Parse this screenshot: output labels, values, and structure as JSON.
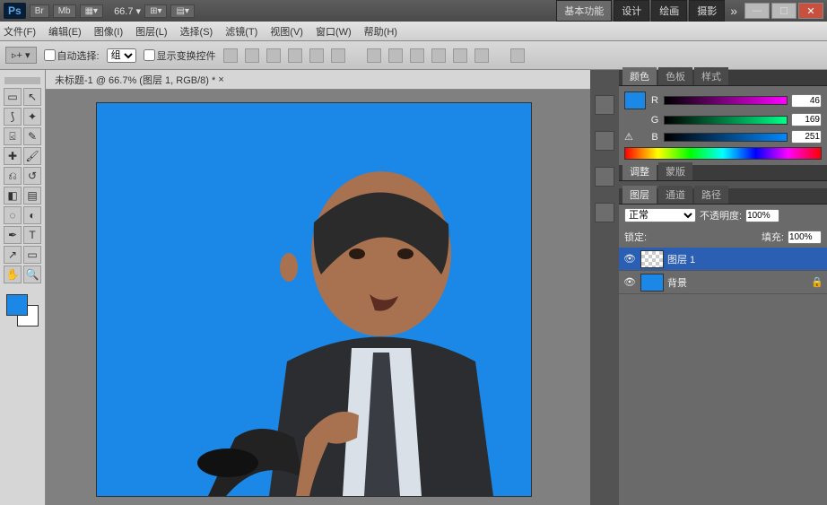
{
  "titlebar": {
    "ps": "Ps",
    "br": "Br",
    "mb": "Mb",
    "zoom_value": "66.7",
    "workspaces": [
      "基本功能",
      "设计",
      "绘画",
      "摄影"
    ],
    "arrow": "»"
  },
  "menubar": {
    "items": [
      "文件(F)",
      "编辑(E)",
      "图像(I)",
      "图层(L)",
      "选择(S)",
      "滤镜(T)",
      "视图(V)",
      "窗口(W)",
      "帮助(H)"
    ]
  },
  "optbar": {
    "auto_select": "自动选择:",
    "group": "组",
    "transform": "显示变换控件"
  },
  "doctab": {
    "title": "未标题-1 @ 66.7% (图层 1, RGB/8) *"
  },
  "panels": {
    "color_tabs": [
      "颜色",
      "色板",
      "样式"
    ],
    "rgb": {
      "r": "R",
      "g": "G",
      "b": "B",
      "r_val": "46",
      "g_val": "169",
      "b_val": "251"
    },
    "adjust_tabs": [
      "调整",
      "蒙版"
    ],
    "layer_tabs": [
      "图层",
      "通道",
      "路径"
    ],
    "blend_mode": "正常",
    "opacity_label": "不透明度:",
    "opacity": "100%",
    "lock_label": "锁定:",
    "fill_label": "填充:",
    "fill": "100%",
    "layers": [
      {
        "name": "图层 1",
        "active": true
      },
      {
        "name": "背景",
        "active": false,
        "locked": true
      }
    ]
  },
  "colors": {
    "canvas_bg": "#1b87e6",
    "fg": "#1b87e6",
    "bg": "#ffffff"
  }
}
